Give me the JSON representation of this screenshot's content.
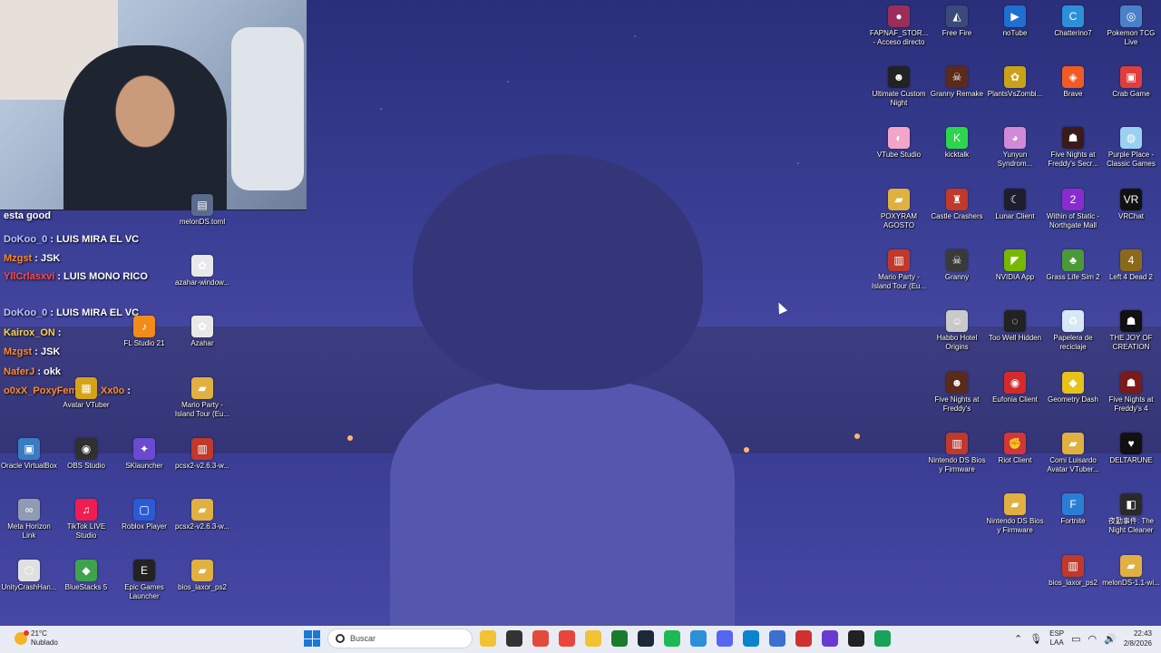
{
  "chat": {
    "header": "esta good",
    "messages": [
      {
        "user": "DoKoo_0",
        "text": ": LUIS MIRA EL VC",
        "color": "blue"
      },
      {
        "user": "Mzgst",
        "text": ": JSK",
        "color": "orange"
      },
      {
        "user": "YllCrlasxvi",
        "text": ": LUIS MONO RICO",
        "color": "red"
      },
      {
        "user": "DoKoo_0",
        "text": ": LUIS MIRA EL VC",
        "color": "blue"
      },
      {
        "user": "Kairox_ON",
        "text": ":",
        "color": "gold"
      },
      {
        "user": "Mzgst",
        "text": ": JSK",
        "color": "orange"
      },
      {
        "user": "NaferJ",
        "text": ": okk",
        "color": "orange"
      },
      {
        "user": "o0xX_PoxyFemboy_Xx0o",
        "text": ":",
        "color": "orange"
      }
    ]
  },
  "left_icons": [
    {
      "label": "melonDS.toml",
      "color": "#5a6b8c",
      "glyph": "▤"
    },
    {
      "label": "azahar-window...",
      "color": "#e8e8e8",
      "glyph": "✿"
    },
    {
      "label": "FL Studio 21",
      "color": "#f28b1a",
      "glyph": "♪"
    },
    {
      "label": "Azahar",
      "color": "#e8e8e8",
      "glyph": "✿"
    },
    {
      "label": "Avatar VTuber",
      "color": "#d4a317",
      "glyph": "▦"
    },
    {
      "label": "Mario Party - Island Tour (Eu...",
      "color": "#e0b040",
      "glyph": "▰"
    },
    {
      "label": "Oracle VirtualBox",
      "color": "#3a7cc4",
      "glyph": "▣"
    },
    {
      "label": "OBS Studio",
      "color": "#303030",
      "glyph": "◉"
    },
    {
      "label": "SKlauncher",
      "color": "#6a4ad0",
      "glyph": "✦"
    },
    {
      "label": "pcsx2-v2.6.3-w...",
      "color": "#c0392b",
      "glyph": "▥"
    },
    {
      "label": "Meta Horizon Link",
      "color": "#8f9bb3",
      "glyph": "∞"
    },
    {
      "label": "TikTok LIVE Studio",
      "color": "#ee1d52",
      "glyph": "♫"
    },
    {
      "label": "Roblox Player",
      "color": "#2a5bd7",
      "glyph": "▢"
    },
    {
      "label": "pcsx2-v2.6.3-w...",
      "color": "#e0b040",
      "glyph": "▰"
    },
    {
      "label": "UnityCrashHan...",
      "color": "#e0e0e0",
      "glyph": "⬡"
    },
    {
      "label": "BlueStacks 5",
      "color": "#3fa34d",
      "glyph": "◆"
    },
    {
      "label": "Epic Games Launcher",
      "color": "#222222",
      "glyph": "E"
    },
    {
      "label": "bios_laxor_ps2",
      "color": "#e0b040",
      "glyph": "▰"
    }
  ],
  "right_icons": [
    {
      "label": "FAPNAF_STOR... - Acceso directo",
      "color": "#9b2d5a",
      "glyph": "●"
    },
    {
      "label": "Free Fire",
      "color": "#3a4a7a",
      "glyph": "◭"
    },
    {
      "label": "noTube",
      "color": "#1f6fd1",
      "glyph": "▶"
    },
    {
      "label": "Chatterino7",
      "color": "#2d8fd8",
      "glyph": "C"
    },
    {
      "label": "Pokemon TCG Live",
      "color": "#4a80c8",
      "glyph": "◎"
    },
    {
      "label": "Ultimate Custom Night",
      "color": "#222222",
      "glyph": "☻"
    },
    {
      "label": "Granny Remake",
      "color": "#5a2a1a",
      "glyph": "☠"
    },
    {
      "label": "PlantsVsZombi...",
      "color": "#c9a21a",
      "glyph": "✿"
    },
    {
      "label": "Brave",
      "color": "#f25a24",
      "glyph": "◈"
    },
    {
      "label": "Crab Game",
      "color": "#e03d3d",
      "glyph": "▣"
    },
    {
      "label": "VTube Studio",
      "color": "#f3a5c8",
      "glyph": "◐"
    },
    {
      "label": "kicktalk",
      "color": "#2bd64c",
      "glyph": "K"
    },
    {
      "label": "Yunyun Syndrom...",
      "color": "#d08ad8",
      "glyph": "◕"
    },
    {
      "label": "Five Nights at Freddy's Secr...",
      "color": "#3a1a1a",
      "glyph": "☗"
    },
    {
      "label": "Purple Place - Classic Games",
      "color": "#9ad0f0",
      "glyph": "◍"
    },
    {
      "label": "POXYRAM AGOSTO",
      "color": "#e0b040",
      "glyph": "▰"
    },
    {
      "label": "Castle Crashers",
      "color": "#c0392b",
      "glyph": "♜"
    },
    {
      "label": "Lunar Client",
      "color": "#1e1e2e",
      "glyph": "☾"
    },
    {
      "label": "Within of Static - Northgate Mall",
      "color": "#8a2bd0",
      "glyph": "2"
    },
    {
      "label": "VRChat",
      "color": "#111111",
      "glyph": "VR"
    },
    {
      "label": "Mario Party - Island Tour (Eu...",
      "color": "#c0392b",
      "glyph": "▥"
    },
    {
      "label": "Granny",
      "color": "#3a3a3a",
      "glyph": "☠"
    },
    {
      "label": "NVIDIA App",
      "color": "#76b900",
      "glyph": "◤"
    },
    {
      "label": "Grass Life Sim 2",
      "color": "#4a9a3a",
      "glyph": "♣"
    },
    {
      "label": "Left 4 Dead 2",
      "color": "#8a6a1a",
      "glyph": "4"
    },
    {
      "label": "Habbo Hotel Origins",
      "color": "#c9c9c9",
      "glyph": "☺"
    },
    {
      "label": "Too Well Hidden",
      "color": "#222222",
      "glyph": "◌"
    },
    {
      "label": "Papelera de reciclaje",
      "color": "#d5e8f5",
      "glyph": "♻"
    },
    {
      "label": "THE JOY OF CREATION Demo",
      "color": "#111111",
      "glyph": "☗"
    },
    {
      "label": "Five Nights at Freddy's",
      "color": "#5a2a1a",
      "glyph": "☻"
    },
    {
      "label": "Eufonia Client",
      "color": "#d62a2a",
      "glyph": "◉"
    },
    {
      "label": "Geometry Dash",
      "color": "#e6c21a",
      "glyph": "◆"
    },
    {
      "label": "Five Nights at Freddy's 4",
      "color": "#7a1a1a",
      "glyph": "☗"
    },
    {
      "label": "Nintendo DS Bios y Firmware",
      "color": "#c0392b",
      "glyph": "▥"
    },
    {
      "label": "Riot Client",
      "color": "#d13639",
      "glyph": "✊"
    },
    {
      "label": "Comi Luisardo Avatar VTuber...",
      "color": "#e0b040",
      "glyph": "▰"
    },
    {
      "label": "DELTARUNE",
      "color": "#111111",
      "glyph": "♥"
    },
    {
      "label": "Nintendo DS Bios y Firmware",
      "color": "#e0b040",
      "glyph": "▰"
    },
    {
      "label": "Fortnite",
      "color": "#2a7fd4",
      "glyph": "F"
    },
    {
      "label": "夜勤事件: The Night Cleaner",
      "color": "#2a2a2a",
      "glyph": "◧"
    },
    {
      "label": "bios_laxor_ps2",
      "color": "#c0392b",
      "glyph": "▥"
    },
    {
      "label": "melonDS-1.1-wi...",
      "color": "#e0b040",
      "glyph": "▰"
    }
  ],
  "taskbar": {
    "weather_temp": "21°C",
    "weather_desc": "Nublado",
    "search_placeholder": "Buscar",
    "lang_line1": "ESP",
    "lang_line2": "LAA",
    "time": "22:43",
    "date": "2/8/2026",
    "apps": [
      {
        "name": "file-explorer",
        "color": "#f2c234"
      },
      {
        "name": "task-view",
        "color": "#333333"
      },
      {
        "name": "red-app",
        "color": "#e24a3b"
      },
      {
        "name": "chrome",
        "color": "#e8453c"
      },
      {
        "name": "folder",
        "color": "#f2c234"
      },
      {
        "name": "xbox",
        "color": "#1b7c2c"
      },
      {
        "name": "steam",
        "color": "#1b2838"
      },
      {
        "name": "spotify",
        "color": "#1db954"
      },
      {
        "name": "chatterino",
        "color": "#2d8fd8"
      },
      {
        "name": "discord",
        "color": "#5865f2"
      },
      {
        "name": "vscode",
        "color": "#0a84d0"
      },
      {
        "name": "sheet-app",
        "color": "#3b6fd0"
      },
      {
        "name": "opera",
        "color": "#d0312d"
      },
      {
        "name": "vs-app",
        "color": "#6a3ad0"
      },
      {
        "name": "obs",
        "color": "#222222"
      },
      {
        "name": "notes",
        "color": "#18a35b"
      }
    ]
  }
}
